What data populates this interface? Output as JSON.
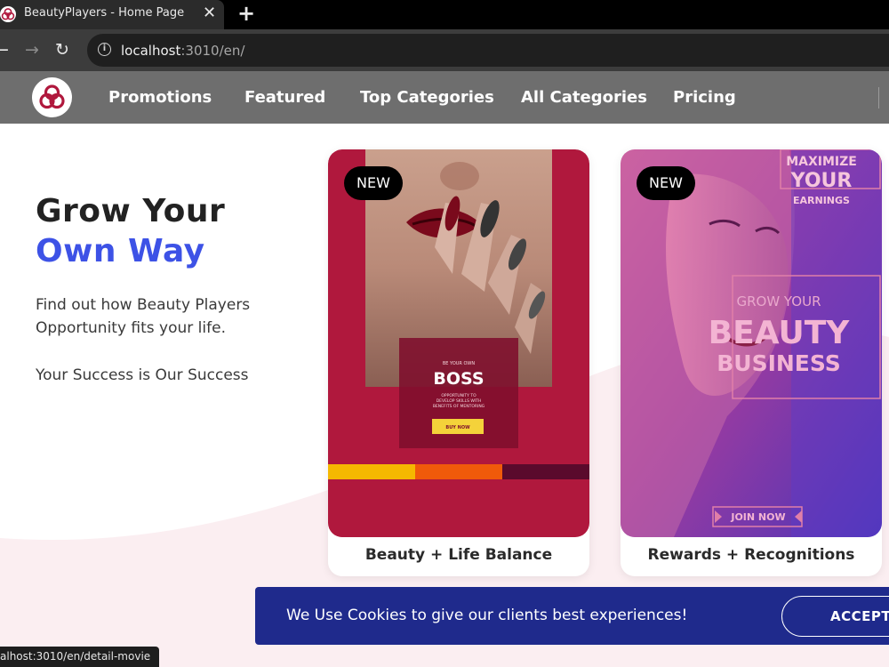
{
  "browser": {
    "tab_title": "BeautyPlayers - Home Page",
    "tab_close": "✕",
    "new_tab": "+",
    "back": "←",
    "forward": "→",
    "reload": "↻",
    "info": "i",
    "url_host": "localhost",
    "url_rest": ":3010/en/",
    "status_url": "alhost:3010/en/detail-movie"
  },
  "nav": {
    "items": [
      "Promotions",
      "Featured",
      "Top Categories",
      "All Categories",
      "Pricing"
    ]
  },
  "hero": {
    "title_line1": "Grow Your",
    "title_line2": "Own Way",
    "text_line1": "Find out how Beauty Players",
    "text_line2": "Opportunity fits your life.",
    "text_line3": "Your Success is Our Success"
  },
  "cards": [
    {
      "badge": "NEW",
      "caption": "Beauty + Life Balance",
      "poster": {
        "kicker": "BE YOUR OWN",
        "headline": "BOSS",
        "sub1": "OPPORTUNITY TO",
        "sub2": "DEVELOP SKILLS WITH",
        "sub3": "BENEFITS OF MENTORING",
        "button": "BUY NOW"
      }
    },
    {
      "badge": "NEW",
      "caption": "Rewards + Recognitions",
      "poster": {
        "top1": "MAXIMIZE",
        "top2": "YOUR",
        "top3": "EARNINGS",
        "mid1": "GROW YOUR",
        "mid2": "BEAUTY",
        "mid3": "BUSINESS",
        "button": "JOIN NOW"
      }
    }
  ],
  "cookie": {
    "text": "We Use Cookies to give our clients best experiences!",
    "accept": "ACCEPT"
  },
  "colors": {
    "accent_blue": "#3d52e6",
    "cookie_bg": "#1f2a8c",
    "nav_bg": "#6e6e6e",
    "card1_red": "#b0183d"
  }
}
